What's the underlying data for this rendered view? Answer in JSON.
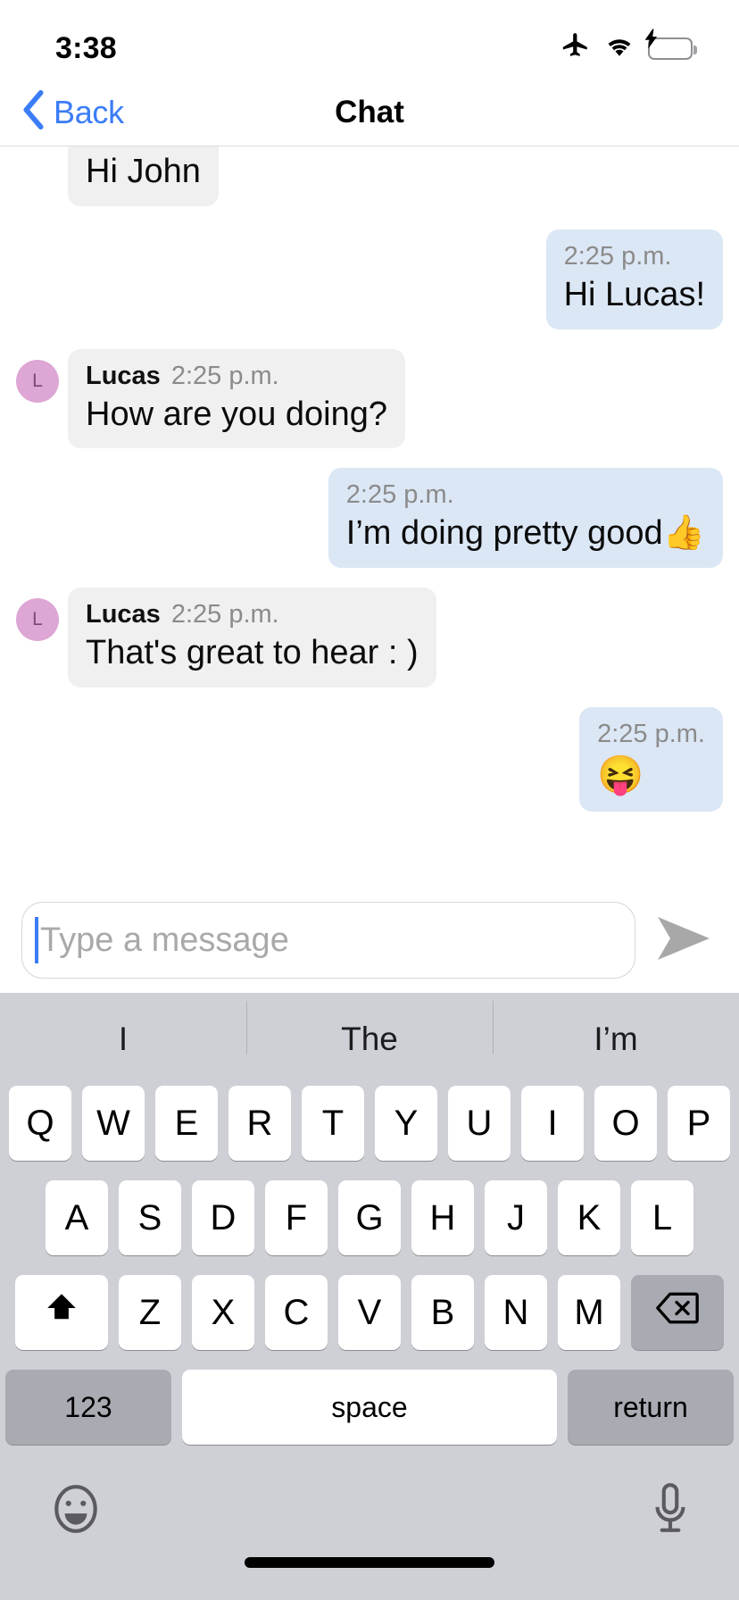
{
  "status_bar": {
    "time": "3:38",
    "icons": [
      "airplane-mode-icon",
      "wifi-icon",
      "battery-charging-icon"
    ]
  },
  "nav_bar": {
    "back_label": "Back",
    "back_icon": "chevron-left-icon",
    "title": "Chat"
  },
  "conversation": {
    "messages": [
      {
        "id": "m1",
        "side": "left",
        "sender": "",
        "time": "",
        "text": "Hi John",
        "avatar_initial": "",
        "show_avatar": false,
        "clipped": true,
        "emoji_only": false
      },
      {
        "id": "m2",
        "side": "right",
        "sender": "",
        "time": "2:25 p.m.",
        "text": "Hi Lucas!",
        "avatar_initial": "",
        "show_avatar": false,
        "clipped": false,
        "emoji_only": false
      },
      {
        "id": "m3",
        "side": "left",
        "sender": "Lucas",
        "time": "2:25 p.m.",
        "text": "How are you doing?",
        "avatar_initial": "L",
        "show_avatar": true,
        "clipped": false,
        "emoji_only": false
      },
      {
        "id": "m4",
        "side": "right",
        "sender": "",
        "time": "2:25 p.m.",
        "text": "I’m doing pretty good👍",
        "avatar_initial": "",
        "show_avatar": false,
        "clipped": false,
        "emoji_only": false
      },
      {
        "id": "m5",
        "side": "left",
        "sender": "Lucas",
        "time": "2:25 p.m.",
        "text": "That's great to hear : )",
        "avatar_initial": "L",
        "show_avatar": true,
        "clipped": false,
        "emoji_only": false
      },
      {
        "id": "m6",
        "side": "right",
        "sender": "",
        "time": "2:25 p.m.",
        "text": "😝",
        "avatar_initial": "",
        "show_avatar": false,
        "clipped": false,
        "emoji_only": true
      }
    ],
    "avatar_color": "#dda6d4",
    "incoming_bubble_color": "#f0f0f0",
    "outgoing_bubble_color": "#dce7f5"
  },
  "composer": {
    "placeholder": "Type a message",
    "value": "",
    "send_icon": "send-arrow-icon"
  },
  "keyboard": {
    "predictions": [
      "I",
      "The",
      "I’m"
    ],
    "row1": [
      "Q",
      "W",
      "E",
      "R",
      "T",
      "Y",
      "U",
      "I",
      "O",
      "P"
    ],
    "row2": [
      "A",
      "S",
      "D",
      "F",
      "G",
      "H",
      "J",
      "K",
      "L"
    ],
    "row3": [
      "Z",
      "X",
      "C",
      "V",
      "B",
      "N",
      "M"
    ],
    "shift_icon": "shift-up-arrow-icon",
    "delete_icon": "backspace-icon",
    "numeric_label": "123",
    "space_label": "space",
    "return_label": "return",
    "emoji_icon": "smiley-face-icon",
    "mic_icon": "microphone-icon",
    "background": "#ced0d6",
    "key_color": "#ffffff",
    "modifier_key_color": "#a9abb2"
  },
  "accent_color": "#3b7cf7"
}
